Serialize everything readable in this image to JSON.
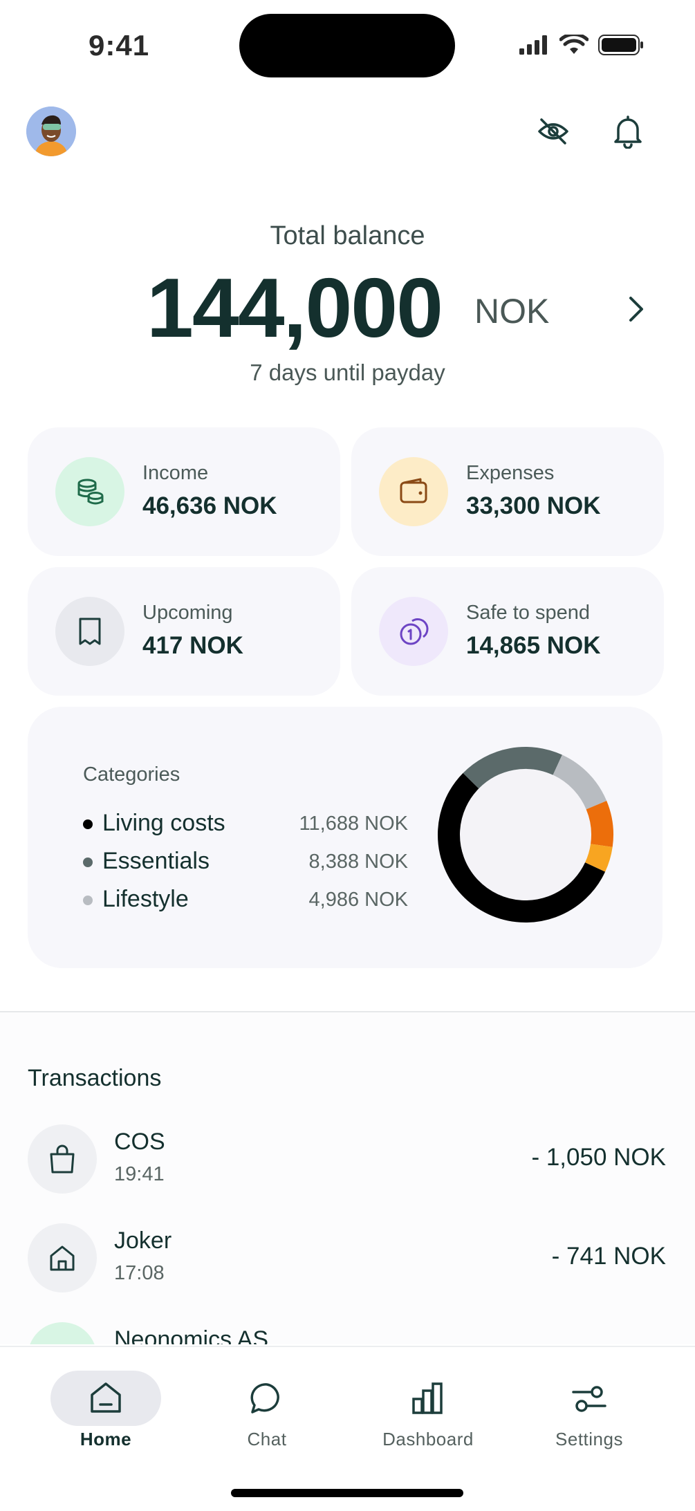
{
  "status_bar": {
    "time": "9:41"
  },
  "balance": {
    "label": "Total balance",
    "amount": "144,000",
    "currency": "NOK",
    "payday_text": "7 days until payday"
  },
  "summary_cards": [
    {
      "label": "Income",
      "value": "46,636 NOK",
      "icon": "coins-icon",
      "color": "#d8f5e4"
    },
    {
      "label": "Expenses",
      "value": "33,300 NOK",
      "icon": "wallet-icon",
      "color": "#fdecc7"
    },
    {
      "label": "Upcoming",
      "value": "417 NOK",
      "icon": "receipt-icon",
      "color": "#e8e9ee"
    },
    {
      "label": "Safe to spend",
      "value": "14,865 NOK",
      "icon": "coin-stack-icon",
      "color": "#efe8fb"
    }
  ],
  "categories": {
    "title": "Categories",
    "items": [
      {
        "name": "Living costs",
        "amount": "11,688 NOK",
        "color": "#000000"
      },
      {
        "name": "Essentials",
        "amount": "8,388 NOK",
        "color": "#5b6a6a"
      },
      {
        "name": "Lifestyle",
        "amount": "4,986 NOK",
        "color": "#b8bcc1"
      }
    ]
  },
  "chart_data": {
    "type": "pie",
    "variant": "donut",
    "segments": [
      {
        "value": 11688,
        "color": "#000000"
      },
      {
        "value": 4100,
        "color": "#5b6a6a"
      },
      {
        "value": 2500,
        "color": "#b8bcc1"
      },
      {
        "value": 1800,
        "color": "#ec6e0b"
      },
      {
        "value": 1000,
        "color": "#f8a521"
      }
    ]
  },
  "transactions": {
    "title": "Transactions",
    "items": [
      {
        "name": "COS",
        "time": "19:41",
        "amount": "- 1,050 NOK",
        "icon": "shopping-bag-icon"
      },
      {
        "name": "Joker",
        "time": "17:08",
        "amount": "- 741 NOK",
        "icon": "house-icon"
      },
      {
        "name": "Neonomics AS",
        "time": "",
        "amount": "",
        "icon": "coins-icon"
      }
    ]
  },
  "tabs": [
    {
      "label": "Home",
      "icon": "home-icon",
      "active": true
    },
    {
      "label": "Chat",
      "icon": "chat-icon",
      "active": false
    },
    {
      "label": "Dashboard",
      "icon": "bar-chart-icon",
      "active": false
    },
    {
      "label": "Settings",
      "icon": "sliders-icon",
      "active": false
    }
  ]
}
